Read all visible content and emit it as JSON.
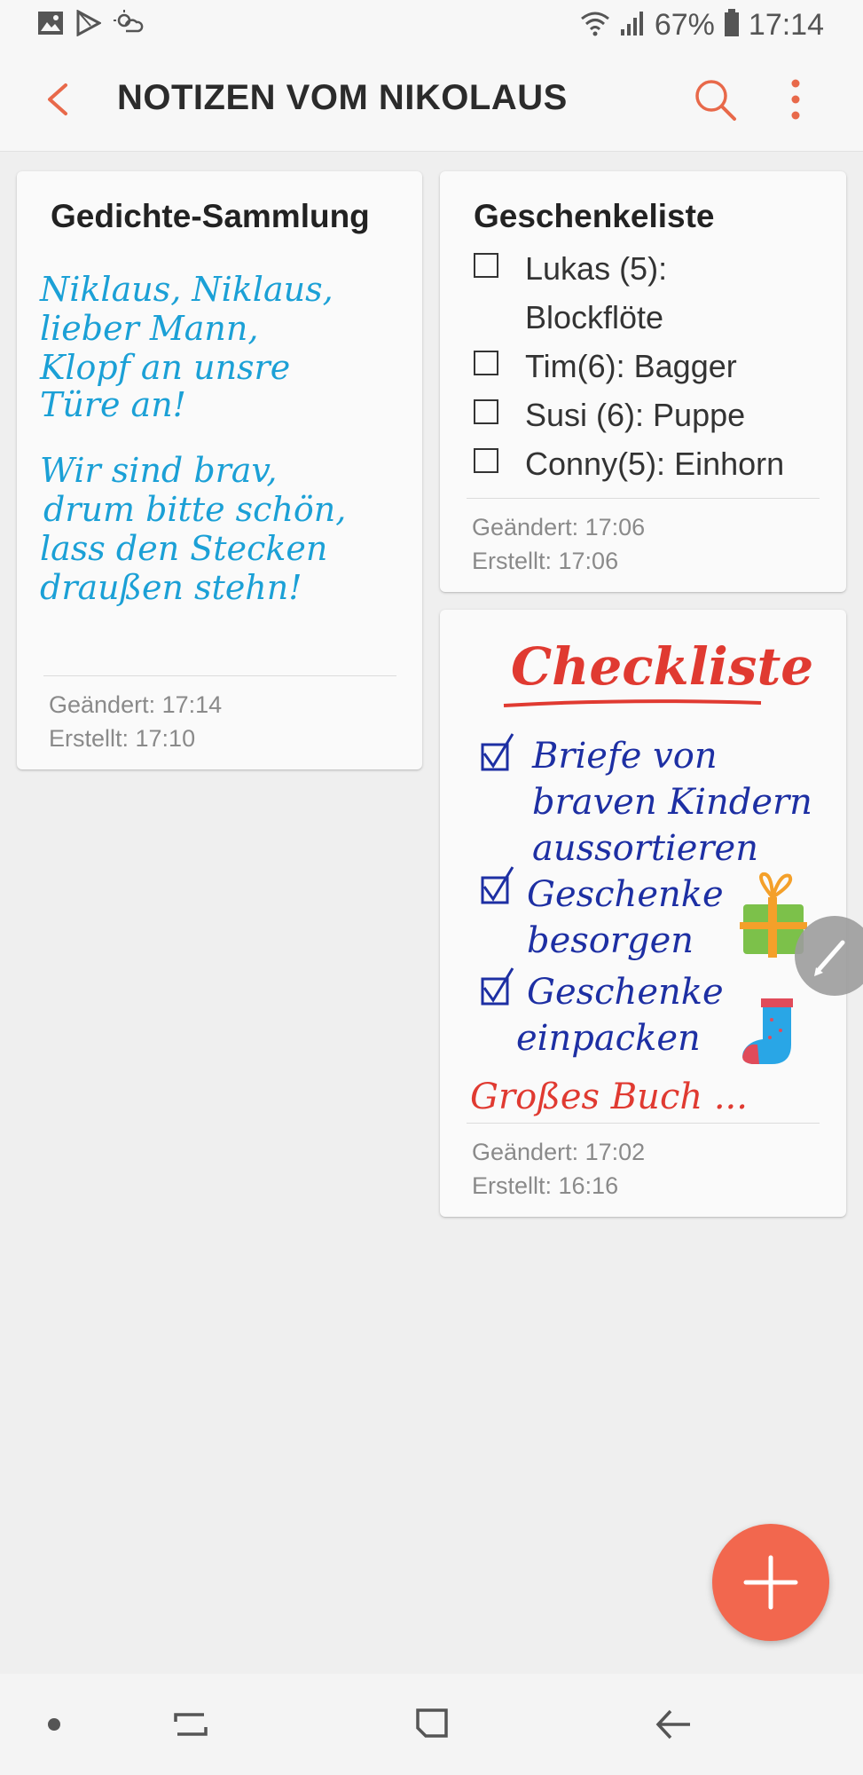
{
  "status_bar": {
    "battery": "67%",
    "time": "17:14",
    "icons_left": [
      "gallery-icon",
      "play-store-icon",
      "weather-icon"
    ],
    "icons_right": [
      "wifi-icon",
      "signal-icon",
      "battery-icon"
    ]
  },
  "app_bar": {
    "title": "NOTIZEN VOM NIKOLAUS",
    "accent": "#e8694a"
  },
  "notes": {
    "poem": {
      "title": "Gedichte-Sammlung",
      "handwriting": [
        "Niklaus, Niklaus,",
        "lieber Mann,",
        "Klopf an unsre",
        "Türe an!",
        "",
        "Wir sind brav,",
        "drum bitte schön,",
        "lass den Stecken",
        "draußen stehn!"
      ],
      "modified": "Geändert: 17:14",
      "created": "Erstellt: 17:10"
    },
    "gifts": {
      "title": "Geschenkeliste",
      "items": [
        "Lukas (5): Blockflöte",
        "Tim(6): Bagger",
        "Susi (6): Puppe",
        "Conny(5): Einhorn"
      ],
      "modified": "Geändert: 17:06",
      "created": "Erstellt: 17:06"
    },
    "checklist": {
      "heading": "Checkliste",
      "lines": [
        "Briefe von",
        "braven Kindern",
        "aussortieren",
        "Geschenke",
        "besorgen",
        "Geschenke",
        "einpacken",
        "Großes Buch ..."
      ],
      "modified": "Geändert: 17:02",
      "created": "Erstellt: 16:16"
    }
  },
  "fab": {
    "icon": "plus-icon",
    "color": "#f2674e"
  },
  "nav_bar": {
    "icons": [
      "dot-icon",
      "recent-apps-icon",
      "home-icon",
      "back-nav-icon"
    ]
  }
}
